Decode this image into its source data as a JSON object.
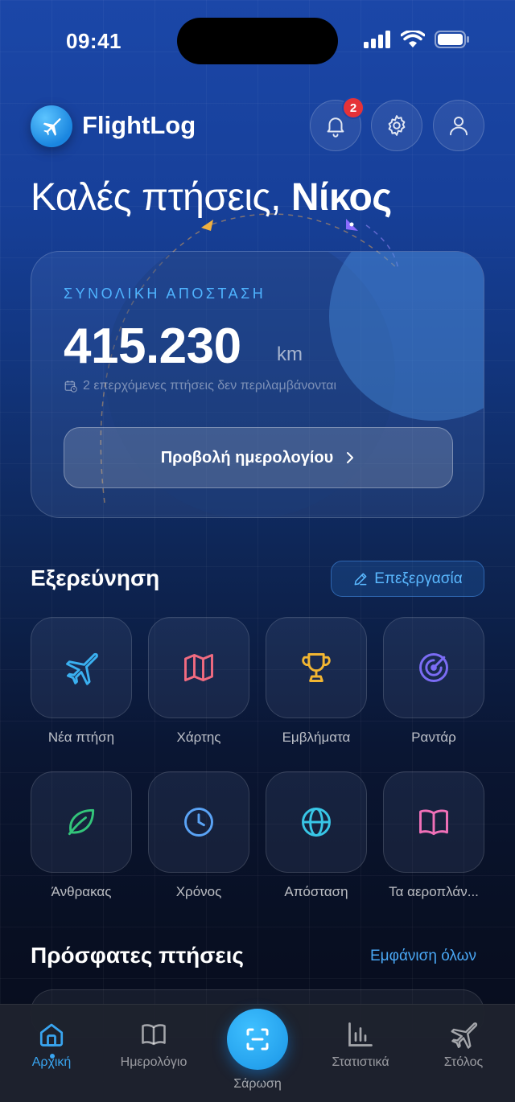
{
  "status": {
    "time": "09:41"
  },
  "header": {
    "app_name": "FlightLog",
    "notification_count": "2"
  },
  "greeting": {
    "prefix": "Καλές πτήσεις, ",
    "name": "Νίκος"
  },
  "distance_card": {
    "label": "ΣΥΝΟΛΙΚΗ ΑΠΟΣΤΑΣΗ",
    "value": "415.230",
    "unit": "km",
    "note": "2 επερχόμενες πτήσεις δεν περιλαμβάνονται",
    "button_label": "Προβολή ημερολογίου"
  },
  "explore": {
    "title": "Εξερεύνηση",
    "edit_label": "Επεξεργασία",
    "tiles": [
      {
        "label": "Νέα πτήση",
        "icon": "plane-icon",
        "color": "#3ab0f0"
      },
      {
        "label": "Χάρτης",
        "icon": "map-icon",
        "color": "#f06b80"
      },
      {
        "label": "Εμβλήματα",
        "icon": "trophy-icon",
        "color": "#f2b632"
      },
      {
        "label": "Ραντάρ",
        "icon": "radar-icon",
        "color": "#7b6cf5"
      },
      {
        "label": "Άνθρακας",
        "icon": "leaf-icon",
        "color": "#33c47a"
      },
      {
        "label": "Χρόνος",
        "icon": "clock-icon",
        "color": "#5aa3f5"
      },
      {
        "label": "Απόσταση",
        "icon": "globe-icon",
        "color": "#38c6e6"
      },
      {
        "label": "Τα αεροπλάν...",
        "icon": "book-icon",
        "color": "#f070b8"
      }
    ]
  },
  "recent": {
    "title": "Πρόσφατες πτήσεις",
    "see_all_label": "Εμφάνιση όλων"
  },
  "tabbar": {
    "home": "Αρχική",
    "logbook": "Ημερολόγιο",
    "scan": "Σάρωση",
    "stats": "Στατιστικά",
    "fleet": "Στόλος"
  },
  "colors": {
    "accent": "#39a5f0",
    "badge": "#e53238"
  }
}
